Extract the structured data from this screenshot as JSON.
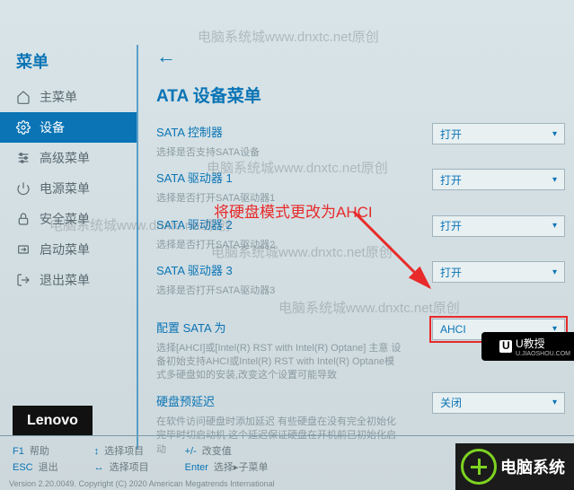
{
  "watermark": "电脑系统城www.dnxtc.net原创",
  "sidebar": {
    "title": "菜单",
    "items": [
      {
        "label": "主菜单",
        "icon": "home-icon"
      },
      {
        "label": "设备",
        "icon": "gear-icon"
      },
      {
        "label": "高级菜单",
        "icon": "sliders-icon"
      },
      {
        "label": "电源菜单",
        "icon": "power-icon"
      },
      {
        "label": "安全菜单",
        "icon": "lock-icon"
      },
      {
        "label": "启动菜单",
        "icon": "boot-icon"
      },
      {
        "label": "退出菜单",
        "icon": "exit-icon"
      }
    ],
    "brand": "Lenovo"
  },
  "page": {
    "title": "ATA 设备菜单",
    "settings": [
      {
        "label": "SATA 控制器",
        "desc": "选择是否支持SATA设备",
        "value": "打开"
      },
      {
        "label": "SATA 驱动器 1",
        "desc": "选择是否打开SATA驱动器1",
        "value": "打开"
      },
      {
        "label": "SATA 驱动器 2",
        "desc": "选择是否打开SATA驱动器2",
        "value": "打开"
      },
      {
        "label": "SATA 驱动器 3",
        "desc": "选择是否打开SATA驱动器3",
        "value": "打开"
      }
    ],
    "configure": {
      "label": "配置 SATA 为",
      "desc": "选择[AHCI]或[Intel(R) RST with Intel(R) Optane]\n主意\n设备初始支持AHCI或Intel(R) RST with Intel(R) Optane模式多硬盘如的安装,改变这个设置可能导致",
      "value": "AHCI"
    },
    "prefetch": {
      "label": "硬盘预延迟",
      "desc": "在软件访问硬盘时添加延迟\n有些硬盘在没有完全初始化完毕时切启动机\n这个延迟保证硬盘在开机前已初始化启动",
      "value": "关闭"
    }
  },
  "annotation": "将硬盘模式更改为AHCI",
  "footer": {
    "f1": "F1",
    "f1_label": "帮助",
    "esc": "ESC",
    "esc_label": "退出",
    "arrows_label": "选择项目",
    "arrows2_label": "选择项目",
    "change_label": "改变值",
    "enter": "Enter",
    "enter_label": "选择▸子菜单"
  },
  "version": "Version 2.20.0049. Copyright (C) 2020 American Megatrends International",
  "overlay": {
    "brand1": "电脑系统",
    "brand2": "U教授",
    "brand2_sub": "U.JIAOSHOU.COM"
  }
}
